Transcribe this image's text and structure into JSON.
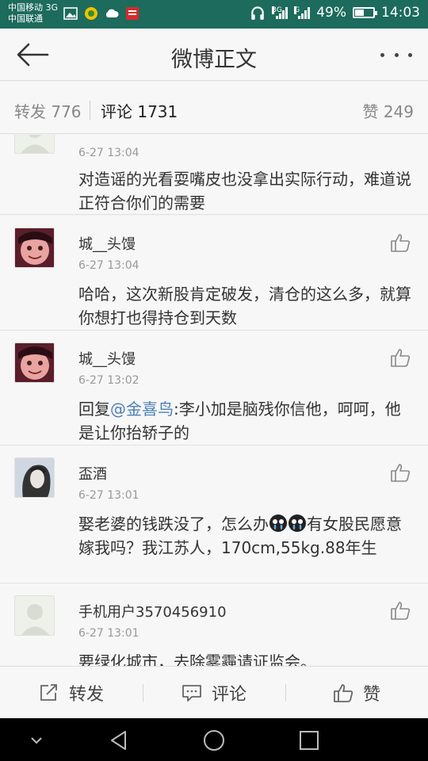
{
  "status_bar": {
    "carrier_line1": "中国移动 3G",
    "carrier_line2": "中国联通",
    "network_1": "3G",
    "network_2": "G",
    "battery_text": "49%",
    "battery_level": 0.49,
    "time": "14:03"
  },
  "header": {
    "title": "微博正文"
  },
  "tabs": {
    "repost": "转发 776",
    "comments": "评论 1731",
    "likes": "赞 249"
  },
  "comments": [
    {
      "time": "6-27 13:04",
      "text": "对造谣的光看耍嘴皮也没拿出实际行动，难道说正符合你们的需要"
    },
    {
      "name": "城__头馒",
      "time": "6-27 13:04",
      "text": "哈哈，这次新股肯定破发，清仓的这么多，就算你想打也得持仓到天数"
    },
    {
      "name": "城__头馒",
      "time": "6-27 13:02",
      "text_before": "回复",
      "mention": "@金喜鸟",
      "text_after": ":李小加是脑残你信他，呵呵，他是让你抬轿子的"
    },
    {
      "name": "盃酒",
      "time": "6-27 13:01",
      "text_before": "娶老婆的钱跌没了，怎么办",
      "text_after": "有女股民愿意嫁我吗？我江苏人，170cm,55kg.88年生",
      "emoji": "crying-face-icon"
    },
    {
      "name": "手机用户3570456910",
      "time": "6-27 13:01",
      "text": "要绿化城市，去除雾霾请证监会。"
    }
  ],
  "action_bar": {
    "repost": "转发",
    "comment": "评论",
    "like": "赞"
  },
  "colors": {
    "status_bar": "#1c6b5c",
    "mention": "#4a7fb8"
  }
}
